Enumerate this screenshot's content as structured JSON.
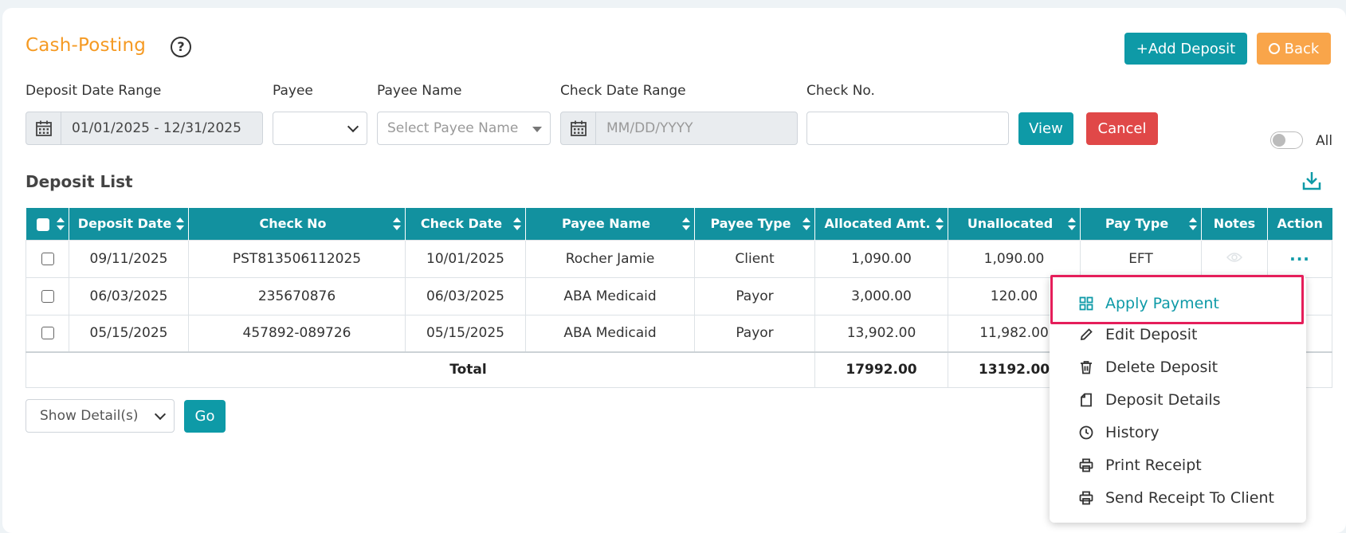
{
  "header": {
    "title": "Cash-Posting",
    "help_symbol": "?",
    "add_deposit_label": "+Add Deposit",
    "back_label": "Back"
  },
  "filters": {
    "deposit_date_range_label": "Deposit Date Range",
    "deposit_date_range_value": "01/01/2025 - 12/31/2025",
    "payee_label": "Payee",
    "payee_value": "",
    "payee_name_label": "Payee Name",
    "payee_name_placeholder": "Select Payee Name",
    "check_date_range_label": "Check Date Range",
    "check_date_range_placeholder": "MM/DD/YYYY",
    "check_no_label": "Check No.",
    "check_no_value": "",
    "view_label": "View",
    "cancel_label": "Cancel",
    "all_label": "All",
    "all_toggle_on": false
  },
  "list": {
    "title": "Deposit List",
    "columns": [
      "Deposit Date",
      "Check No",
      "Check Date",
      "Payee Name",
      "Payee Type",
      "Allocated Amt.",
      "Unallocated",
      "Pay Type",
      "Notes",
      "Action"
    ],
    "rows": [
      {
        "deposit_date": "09/11/2025",
        "check_no": "PST813506112025",
        "check_date": "10/01/2025",
        "payee_name": "Rocher Jamie",
        "payee_type": "Client",
        "allocated": "1,090.00",
        "unallocated": "1,090.00",
        "pay_type": "EFT"
      },
      {
        "deposit_date": "06/03/2025",
        "check_no": "235670876",
        "check_date": "06/03/2025",
        "payee_name": "ABA Medicaid",
        "payee_type": "Payor",
        "allocated": "3,000.00",
        "unallocated": "120.00",
        "pay_type": ""
      },
      {
        "deposit_date": "05/15/2025",
        "check_no": "457892-089726",
        "check_date": "05/15/2025",
        "payee_name": "ABA Medicaid",
        "payee_type": "Payor",
        "allocated": "13,902.00",
        "unallocated": "11,982.00",
        "pay_type": ""
      }
    ],
    "total_label": "Total",
    "total_allocated": "17992.00",
    "total_unallocated": "13192.00",
    "action_symbol": "···"
  },
  "footer": {
    "show_details_value": "Show Detail(s)",
    "go_label": "Go"
  },
  "action_menu": {
    "items": [
      "Apply Payment",
      "Edit Deposit",
      "Delete Deposit",
      "Deposit Details",
      "History",
      "Print Receipt",
      "Send Receipt To Client"
    ],
    "active_index": 0
  },
  "colors": {
    "teal": "#0e9aa7",
    "orange": "#f59a23",
    "red": "#e04848",
    "highlight": "#e51e5a"
  }
}
